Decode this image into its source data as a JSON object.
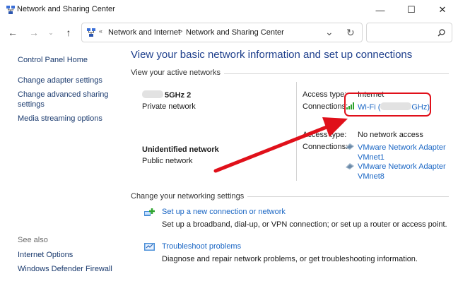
{
  "window": {
    "title": "Network and Sharing Center",
    "controls": {
      "minimize": "—",
      "maximize": "☐",
      "close": "✕"
    }
  },
  "address": {
    "breadcrumbs": [
      "Network and Internet",
      "Network and Sharing Center"
    ],
    "overflow_glyph": "«",
    "separator": ">",
    "search_placeholder": ""
  },
  "sidebar": {
    "items": [
      "Control Panel Home",
      "Change adapter settings",
      "Change advanced sharing settings",
      "Media streaming options"
    ],
    "see_also_label": "See also",
    "see_also": [
      "Internet Options",
      "Windows Defender Firewall"
    ]
  },
  "main": {
    "title": "View your basic network information and set up connections",
    "active_networks_heading": "View your active networks",
    "networks": [
      {
        "name": "5GHz 2",
        "type": "Private network",
        "access_type_label": "Access type:",
        "access_type": "Internet",
        "connections_label": "Connections:",
        "connections": [
          "Wi-Fi (GHz)"
        ]
      },
      {
        "name": "Unidentified network",
        "type": "Public network",
        "access_type_label": "Access type:",
        "access_type": "No network access",
        "connections_label": "Connections:",
        "connections": [
          "VMware Network Adapter VMnet1",
          "VMware Network Adapter VMnet8"
        ]
      }
    ],
    "change_settings_heading": "Change your networking settings",
    "tasks": [
      {
        "link": "Set up a new connection or network",
        "description": "Set up a broadband, dial-up, or VPN connection; or set up a router or access point."
      },
      {
        "link": "Troubleshoot problems",
        "description": "Diagnose and repair network problems, or get troubleshooting information."
      }
    ]
  },
  "colors": {
    "link": "#1a66c4",
    "title": "#1e3f8c",
    "highlight": "#e0101a"
  }
}
